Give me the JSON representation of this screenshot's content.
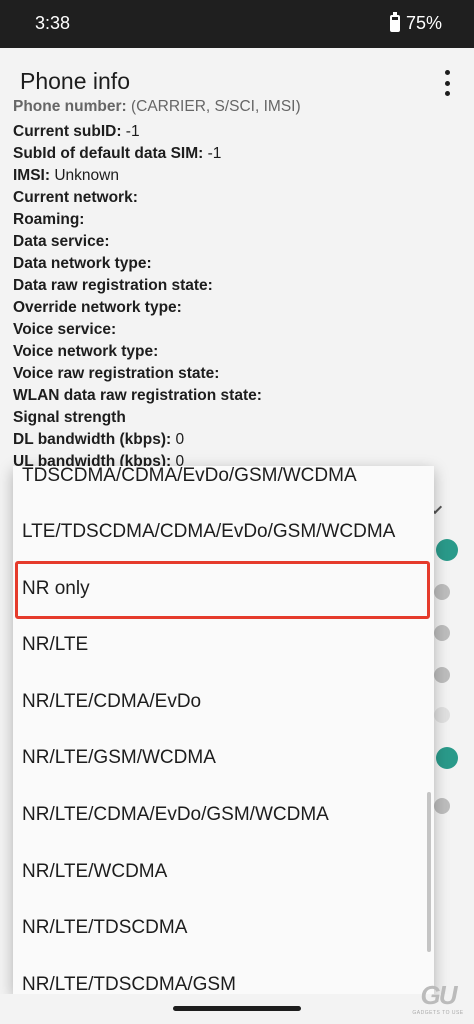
{
  "status_bar": {
    "time": "3:38",
    "battery": "75%",
    "battery_icon": "battery-charging-icon"
  },
  "app_bar": {
    "title": "Phone info",
    "menu_icon": "more-vert-icon"
  },
  "info_rows": [
    {
      "label": "Phone number:",
      "value": " (CARRIER, S/SCI, IMSI)"
    },
    {
      "label": "Current subID:",
      "value": " -1"
    },
    {
      "label": "SubId of default data SIM:",
      "value": " -1"
    },
    {
      "label": "IMSI:",
      "value": " Unknown"
    },
    {
      "label": "Current network:",
      "value": ""
    },
    {
      "label": "Roaming:",
      "value": ""
    },
    {
      "label": "Data service:",
      "value": ""
    },
    {
      "label": "Data network type:",
      "value": ""
    },
    {
      "label": "Data raw registration state:",
      "value": ""
    },
    {
      "label": "Override network type:",
      "value": ""
    },
    {
      "label": "Voice service:",
      "value": ""
    },
    {
      "label": "Voice network type:",
      "value": ""
    },
    {
      "label": "Voice raw registration state:",
      "value": ""
    },
    {
      "label": "WLAN data raw registration state:",
      "value": ""
    },
    {
      "label": "Signal strength",
      "value": ""
    },
    {
      "label": "DL bandwidth (kbps):",
      "value": " 0"
    },
    {
      "label": "UL bandwidth (kbps):",
      "value": " 0"
    }
  ],
  "dropdown": {
    "options": [
      "TDSCDMA/CDMA/EvDo/GSM/WCDMA",
      "LTE/TDSCDMA/CDMA/EvDo/GSM/WCDMA",
      "NR only",
      "NR/LTE",
      "NR/LTE/CDMA/EvDo",
      "NR/LTE/GSM/WCDMA",
      "NR/LTE/CDMA/EvDo/GSM/WCDMA",
      "NR/LTE/WCDMA",
      "NR/LTE/TDSCDMA",
      "NR/LTE/TDSCDMA/GSM"
    ],
    "highlighted_option": "NR only",
    "highlight_color": "#e53b2b"
  },
  "watermark": {
    "logo": "GU",
    "tagline": "GADGETS TO USE"
  },
  "colors": {
    "status_bar": "#1f1f1f",
    "background": "#f3f3f3",
    "toggle_on": "#2a9a8a"
  }
}
